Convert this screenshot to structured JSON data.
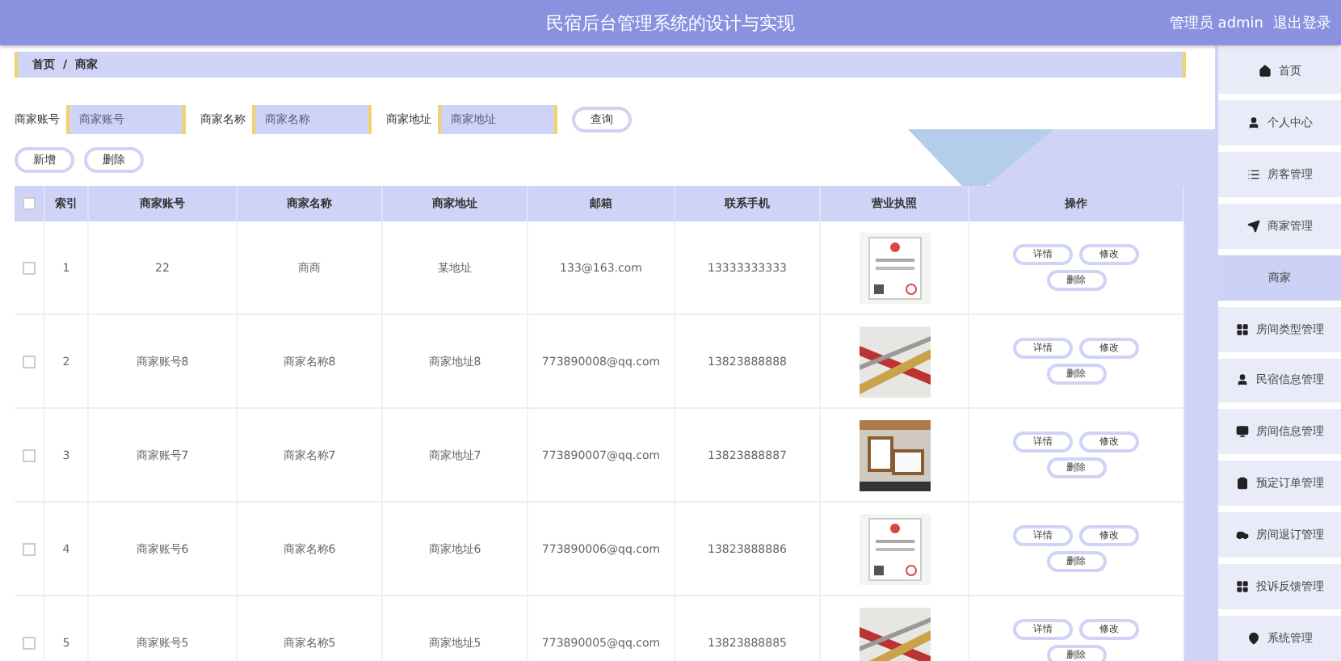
{
  "header": {
    "title": "民宿后台管理系统的设计与实现",
    "user": "管理员 admin",
    "logout": "退出登录"
  },
  "breadcrumb": [
    "首页",
    "/",
    "商家"
  ],
  "search": {
    "fields": [
      {
        "label": "商家账号",
        "placeholder": "商家账号"
      },
      {
        "label": "商家名称",
        "placeholder": "商家名称"
      },
      {
        "label": "商家地址",
        "placeholder": "商家地址"
      }
    ],
    "button": "查询"
  },
  "actions": [
    "新增",
    "删除"
  ],
  "table": {
    "columns": [
      "索引",
      "商家账号",
      "商家名称",
      "商家地址",
      "邮箱",
      "联系手机",
      "营业执照",
      "操作"
    ],
    "header_checked": false,
    "rows": [
      {
        "checked": false,
        "cells": [
          "1",
          "22",
          "商商",
          "某地址",
          "133@163.com",
          "13333333333"
        ],
        "buttons": [
          "详情",
          "修改",
          "删除"
        ]
      },
      {
        "checked": false,
        "cells": [
          "2",
          "商家账号8",
          "商家名称8",
          "商家地址8",
          "773890008@qq.com",
          "13823888888"
        ],
        "buttons": [
          "详情",
          "修改",
          "删除"
        ]
      },
      {
        "checked": false,
        "cells": [
          "3",
          "商家账号7",
          "商家名称7",
          "商家地址7",
          "773890007@qq.com",
          "13823888887"
        ],
        "buttons": [
          "详情",
          "修改",
          "删除"
        ]
      },
      {
        "checked": false,
        "cells": [
          "4",
          "商家账号6",
          "商家名称6",
          "商家地址6",
          "773890006@qq.com",
          "13823888886"
        ],
        "buttons": [
          "详情",
          "修改",
          "删除"
        ]
      },
      {
        "checked": false,
        "cells": [
          "5",
          "商家账号5",
          "商家名称5",
          "商家地址5",
          "773890005@qq.com",
          "13823888885"
        ],
        "buttons": [
          "详情",
          "修改",
          "删除"
        ]
      }
    ]
  },
  "sidebar": {
    "items": [
      {
        "label": "首页",
        "selected": false
      },
      {
        "label": "个人中心",
        "selected": false
      },
      {
        "label": "房客管理",
        "selected": false
      },
      {
        "label": "商家管理",
        "selected": false
      },
      {
        "label": "商家",
        "selected": true
      },
      {
        "label": "房间类型管理",
        "selected": false
      },
      {
        "label": "民宿信息管理",
        "selected": false
      },
      {
        "label": "房间信息管理",
        "selected": false
      },
      {
        "label": "预定订单管理",
        "selected": false
      },
      {
        "label": "房间退订管理",
        "selected": false
      },
      {
        "label": "投诉反馈管理",
        "selected": false
      },
      {
        "label": "系统管理",
        "selected": false
      }
    ]
  }
}
